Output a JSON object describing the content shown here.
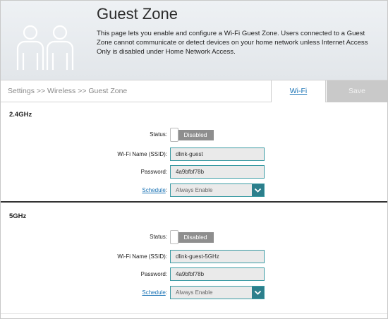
{
  "header": {
    "title": "Guest Zone",
    "description": "This page lets you enable and configure a Wi-Fi Guest Zone. Users connected to a Guest Zone cannot communicate or detect devices on your home network unless Internet Access Only is disabled under Home Network Access."
  },
  "breadcrumb": "Settings >> Wireless >> Guest Zone",
  "toolbar": {
    "wifi_link": "Wi-Fi",
    "save_label": "Save"
  },
  "band_24": {
    "title": "2.4GHz",
    "status_label": "Status:",
    "status_value": "Disabled",
    "ssid_label": "Wi-Fi Name (SSID):",
    "ssid_value": "dlink-guest",
    "password_label": "Password:",
    "password_value": "4a9bfbf78b",
    "schedule_link": "Schedule",
    "schedule_colon": ":",
    "schedule_value": "Always Enable"
  },
  "band_5": {
    "title": "5GHz",
    "status_label": "Status:",
    "status_value": "Disabled",
    "ssid_label": "Wi-Fi Name (SSID):",
    "ssid_value": "dlink-guest-5GHz",
    "password_label": "Password:",
    "password_value": "4a9bfbf78b",
    "schedule_link": "Schedule",
    "schedule_colon": ":",
    "schedule_value": "Always Enable"
  },
  "colors": {
    "accent": "#2c7f8c",
    "link": "#1a73b5",
    "toggle_off": "#8e8e8e"
  }
}
